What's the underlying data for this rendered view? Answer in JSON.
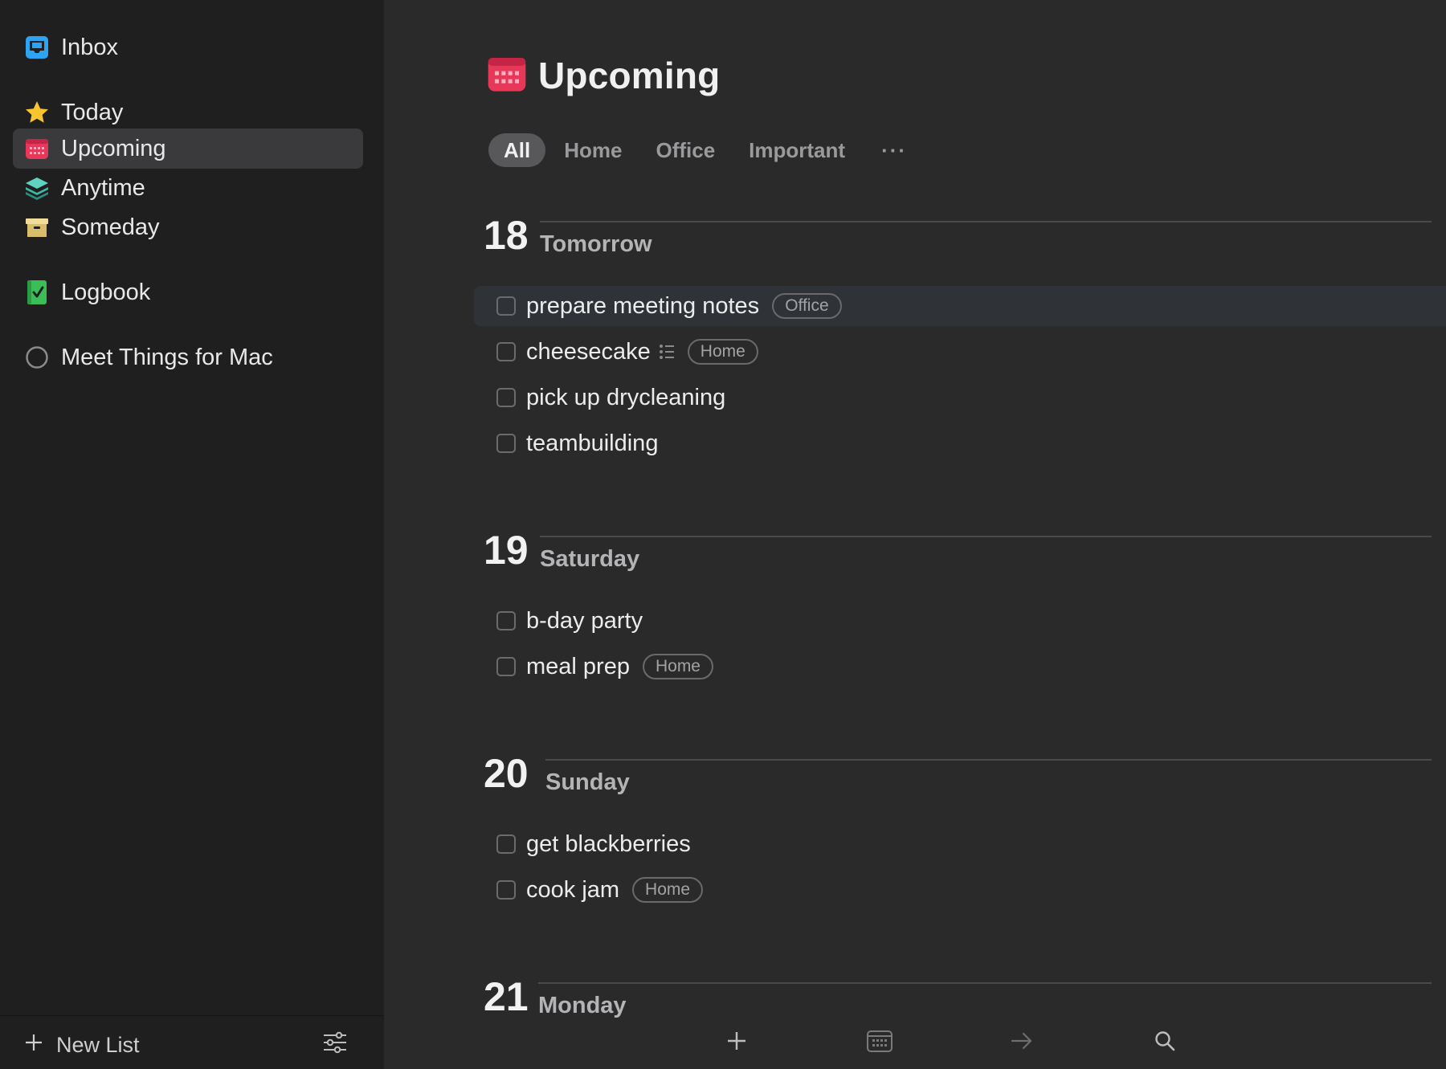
{
  "sidebar": {
    "items": [
      {
        "label": "Inbox",
        "icon": "inbox-icon"
      },
      {
        "label": "Today",
        "icon": "star-icon"
      },
      {
        "label": "Upcoming",
        "icon": "calendar-icon",
        "active": true
      },
      {
        "label": "Anytime",
        "icon": "stack-icon"
      },
      {
        "label": "Someday",
        "icon": "box-icon"
      },
      {
        "label": "Logbook",
        "icon": "logbook-icon"
      },
      {
        "label": "Meet Things for Mac",
        "icon": "circle-icon"
      }
    ],
    "new_list_label": "New List"
  },
  "main": {
    "title": "Upcoming",
    "tabs": [
      {
        "label": "All",
        "active": true
      },
      {
        "label": "Home"
      },
      {
        "label": "Office"
      },
      {
        "label": "Important"
      },
      {
        "label": "···"
      }
    ],
    "days": [
      {
        "num": "18",
        "name": "Tomorrow",
        "tasks": [
          {
            "title": "prepare meeting notes",
            "tag": "Office"
          },
          {
            "title": "cheesecake",
            "checklist": true,
            "tag": "Home"
          },
          {
            "title": "pick up drycleaning"
          },
          {
            "title": "teambuilding"
          }
        ]
      },
      {
        "num": "19",
        "name": "Saturday",
        "tasks": [
          {
            "title": "b-day party"
          },
          {
            "title": "meal prep",
            "tag": "Home"
          }
        ]
      },
      {
        "num": "20",
        "name": "Sunday",
        "tasks": [
          {
            "title": "get blackberries"
          },
          {
            "title": "cook jam",
            "tag": "Home"
          }
        ]
      },
      {
        "num": "21",
        "name": "Monday",
        "tasks": []
      }
    ]
  },
  "toolbar": {
    "buttons": [
      "plus-icon",
      "calendar-icon",
      "arrow-right-icon",
      "search-icon"
    ]
  },
  "colors": {
    "sidebar_bg": "#1f1f20",
    "main_bg": "#2a2a2b",
    "upcoming_red": "#e8385a",
    "inbox_blue": "#2ea3f2",
    "today_yellow": "#f7c52d",
    "anytime_teal": "#3fb8a6",
    "someday_tan": "#e8d08a",
    "logbook_green": "#3cbe57"
  }
}
